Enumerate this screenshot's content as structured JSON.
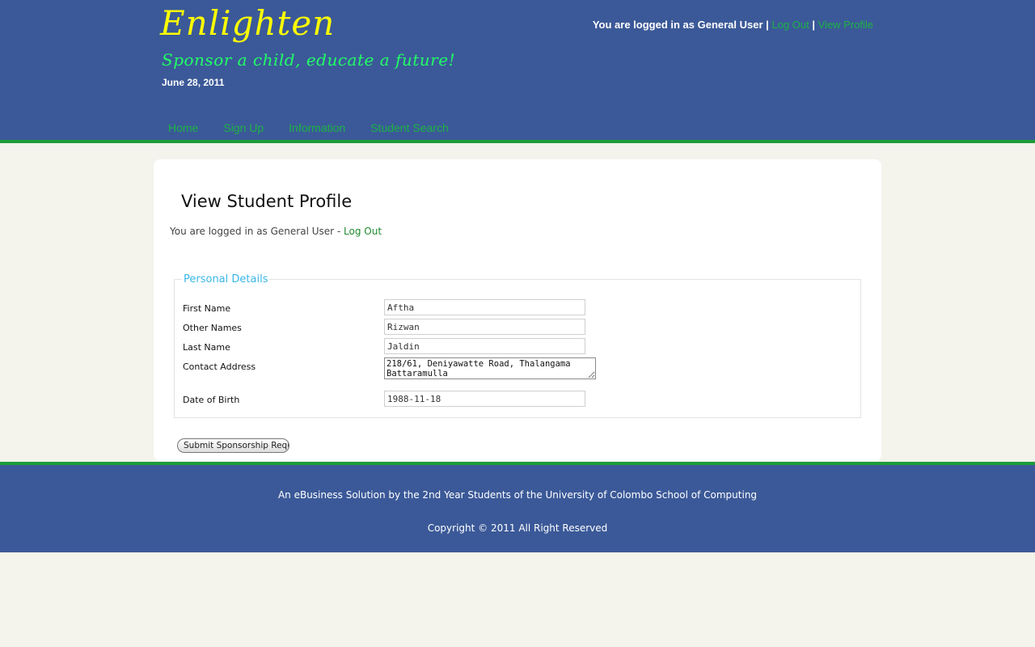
{
  "header": {
    "site_title": "Enlighten",
    "tagline": "Sponsor a child, educate a future!",
    "date": "June 28, 2011",
    "login_text": "You are logged in as General User",
    "sep1": "|",
    "sep2": "|",
    "logout_label": "Log Out",
    "view_profile_label": "View Profile"
  },
  "nav": {
    "items": [
      {
        "label": "Home"
      },
      {
        "label": "Sign Up"
      },
      {
        "label": "Information"
      },
      {
        "label": "Student Search"
      }
    ]
  },
  "main": {
    "page_title": "View Student Profile",
    "login_text": "You are logged in as General User - ",
    "logout_label": "Log Out",
    "fieldset_legend": "Personal Details",
    "fields": {
      "first_name": {
        "label": "First Name",
        "value": "Aftha"
      },
      "other_names": {
        "label": "Other Names",
        "value": "Rizwan"
      },
      "last_name": {
        "label": "Last Name",
        "value": "Jaldin"
      },
      "contact_address": {
        "label": "Contact Address",
        "value": "218/61, Deniyawatte Road, Thalangama\nBattaramulla"
      },
      "date_of_birth": {
        "label": "Date of Birth",
        "value": "1988-11-18"
      }
    },
    "submit_label": "Submit Sponsorship Request"
  },
  "footer": {
    "line1": "An eBusiness Solution by the 2nd Year Students of the University of Colombo School of Computing",
    "line2": "Copyright © 2011 All Right Reserved"
  },
  "colors": {
    "header_bg": "#3b5998",
    "accent_green": "#1d9b3a",
    "link_green": "#1db345",
    "title_yellow": "#ffff00",
    "tagline_green": "#22ff66",
    "legend_blue": "#3ab7e8",
    "page_bg": "#f4f3ec"
  }
}
